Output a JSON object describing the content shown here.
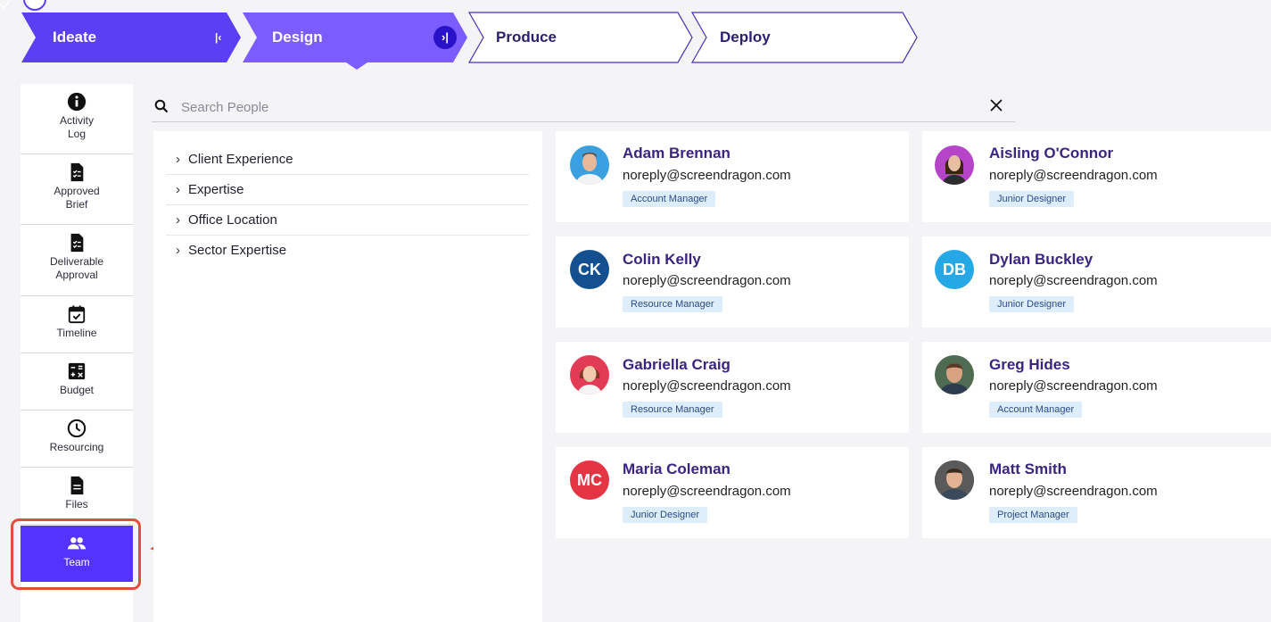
{
  "stepper": {
    "steps": [
      {
        "label": "Ideate",
        "state": "complete"
      },
      {
        "label": "Design",
        "state": "active"
      },
      {
        "label": "Produce",
        "state": "upcoming"
      },
      {
        "label": "Deploy",
        "state": "upcoming"
      }
    ],
    "colors": {
      "complete": "#5b3ff5",
      "active": "#7a5cff",
      "upcoming_border": "#4a2fb5"
    }
  },
  "sidebar": {
    "items": [
      {
        "label": "Activity\nLog",
        "icon": "info-icon"
      },
      {
        "label": "Approved\nBrief",
        "icon": "checklist-document-icon"
      },
      {
        "label": "Deliverable\nApproval",
        "icon": "checklist-document-icon"
      },
      {
        "label": "Timeline",
        "icon": "calendar-check-icon"
      },
      {
        "label": "Budget",
        "icon": "calculator-icon"
      },
      {
        "label": "Resourcing",
        "icon": "clock-icon"
      },
      {
        "label": "Files",
        "icon": "file-icon"
      },
      {
        "label": "Team",
        "icon": "people-icon",
        "active": true
      }
    ],
    "accent": "#5533ff"
  },
  "search": {
    "placeholder": "Search People",
    "value": ""
  },
  "filters": [
    {
      "label": "Client Experience"
    },
    {
      "label": "Expertise"
    },
    {
      "label": "Office Location"
    },
    {
      "label": "Sector Expertise"
    }
  ],
  "people": [
    {
      "name": "Adam Brennan",
      "email": "noreply@screendragon.com",
      "role": "Account Manager",
      "avatar": {
        "type": "photo",
        "bg": "#3aa0e0"
      }
    },
    {
      "name": "Aisling O'Connor",
      "email": "noreply@screendragon.com",
      "role": "Junior Designer",
      "avatar": {
        "type": "photo",
        "bg": "#b544c9"
      }
    },
    {
      "name": "Colin Kelly",
      "email": "noreply@screendragon.com",
      "role": "Resource Manager",
      "avatar": {
        "type": "initials",
        "initials": "CK",
        "bg": "#14508f"
      }
    },
    {
      "name": "Dylan Buckley",
      "email": "noreply@screendragon.com",
      "role": "Junior Designer",
      "avatar": {
        "type": "initials",
        "initials": "DB",
        "bg": "#27a8e6"
      }
    },
    {
      "name": "Gabriella Craig",
      "email": "noreply@screendragon.com",
      "role": "Resource Manager",
      "avatar": {
        "type": "photo",
        "bg": "#e23b55"
      }
    },
    {
      "name": "Greg Hides",
      "email": "noreply@screendragon.com",
      "role": "Account Manager",
      "avatar": {
        "type": "photo",
        "bg": "#4f6b52"
      }
    },
    {
      "name": "Maria Coleman",
      "email": "noreply@screendragon.com",
      "role": "Junior Designer",
      "avatar": {
        "type": "initials",
        "initials": "MC",
        "bg": "#e53545"
      }
    },
    {
      "name": "Matt Smith",
      "email": "noreply@screendragon.com",
      "role": "Project Manager",
      "avatar": {
        "type": "photo",
        "bg": "#2b2b2b"
      }
    }
  ],
  "annotation": {
    "color": "#e04e3c"
  }
}
